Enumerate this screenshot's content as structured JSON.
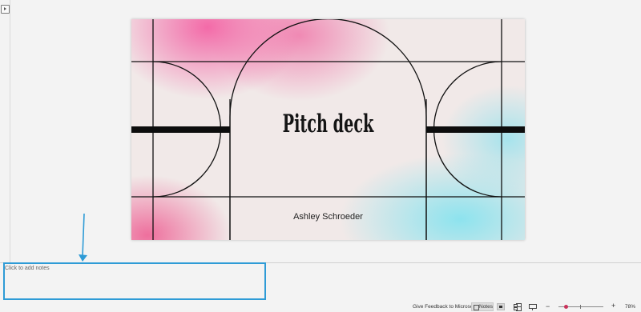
{
  "slide": {
    "title": "Pitch deck",
    "subtitle": "Ashley Schroeder"
  },
  "notes": {
    "placeholder": "Click to add notes"
  },
  "status_bar": {
    "feedback": "Give Feedback to Microsoft",
    "notes_label": "Notes",
    "zoom_minus": "−",
    "zoom_plus": "+",
    "zoom_level": "78%",
    "zoom_value_percent": 78
  },
  "colors": {
    "highlight": "#2e9bd6",
    "zoom_accent": "#c8325a",
    "slide_pink": "#f36aa8",
    "slide_cyan": "#8de3ee"
  },
  "icons": {
    "thumbnail_toggle": "play-slide-icon",
    "notes": "notes-icon",
    "normal_view": "normal-view-icon",
    "sorter_view": "slide-sorter-icon",
    "reading_view": "reading-view-icon"
  }
}
